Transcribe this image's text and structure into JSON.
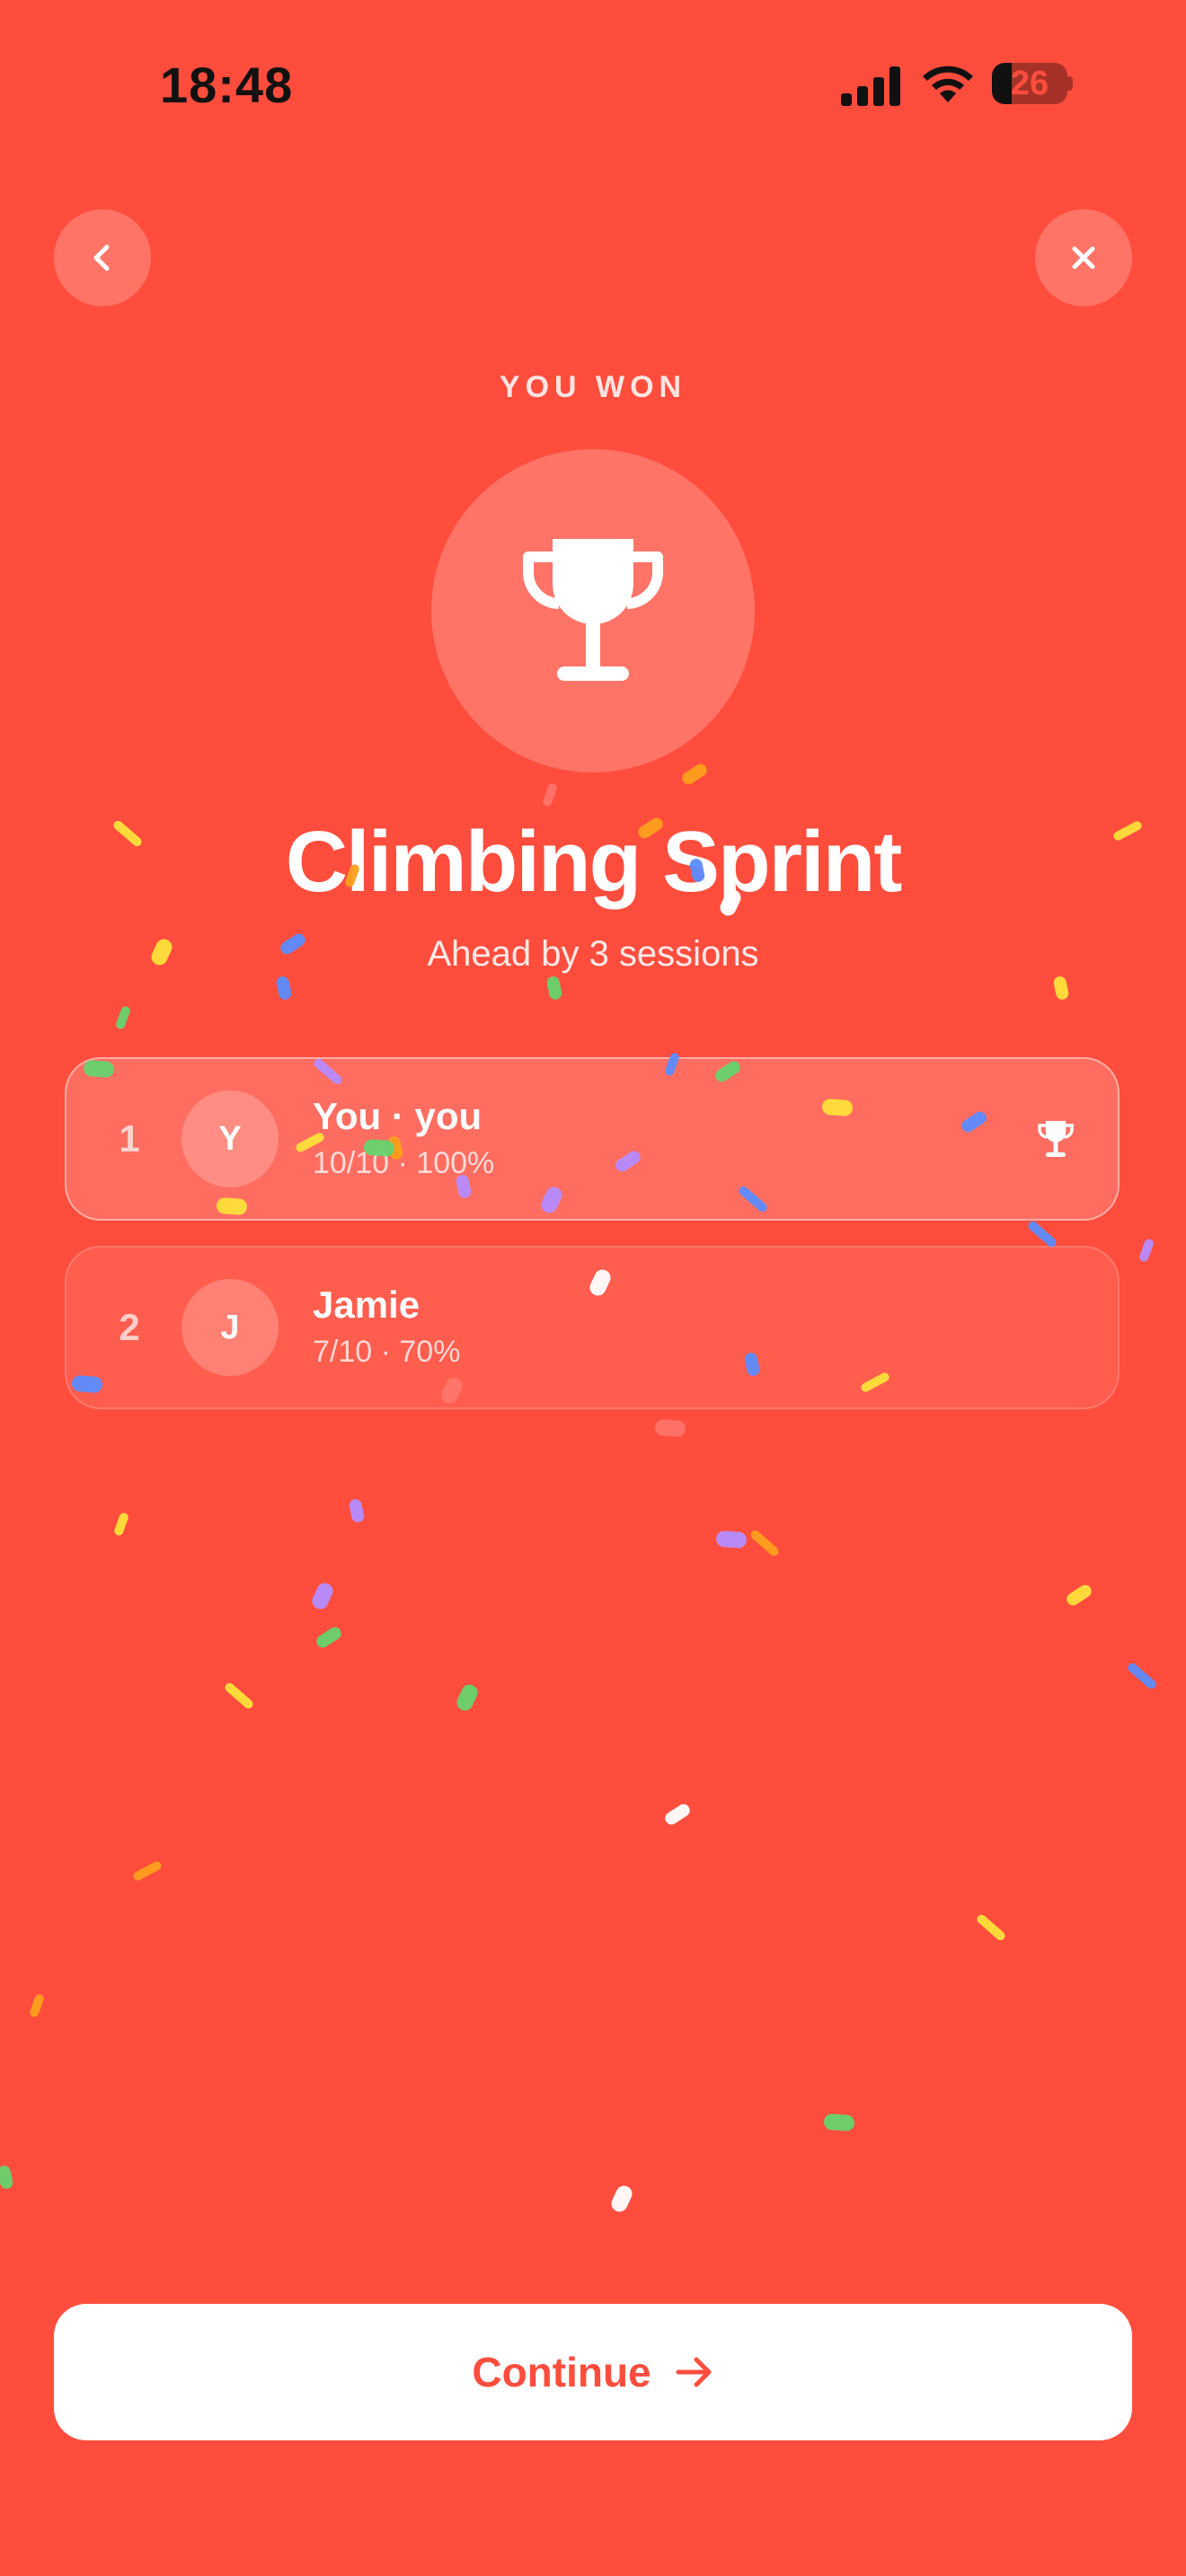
{
  "status_bar": {
    "time": "18:48",
    "battery": "26",
    "battery_level": 0.26
  },
  "header": {
    "eyebrow": "YOU WON",
    "back_icon": "chevron-left-icon",
    "close_icon": "close-icon",
    "badge_icon": "trophy-icon"
  },
  "challenge": {
    "title": "Climbing Sprint",
    "subtitle": "Ahead by 3 sessions"
  },
  "leaderboard": [
    {
      "rank": "1",
      "initial": "Y",
      "name": "You · you",
      "score": "10/10 · 100%",
      "winner": true
    },
    {
      "rank": "2",
      "initial": "J",
      "name": "Jamie",
      "score": "7/10 · 70%",
      "winner": false
    }
  ],
  "footer": {
    "continue_label": "Continue",
    "continue_icon": "arrow-right-icon"
  },
  "colors": {
    "background": "#FF4D3D",
    "accent_text": "#FF4D3D",
    "confetti": [
      "#FFE03A",
      "#5B8CFF",
      "#66D36E",
      "#B58CFF",
      "#FF9F1C",
      "#FFFFFF",
      "#FF7A70"
    ]
  }
}
